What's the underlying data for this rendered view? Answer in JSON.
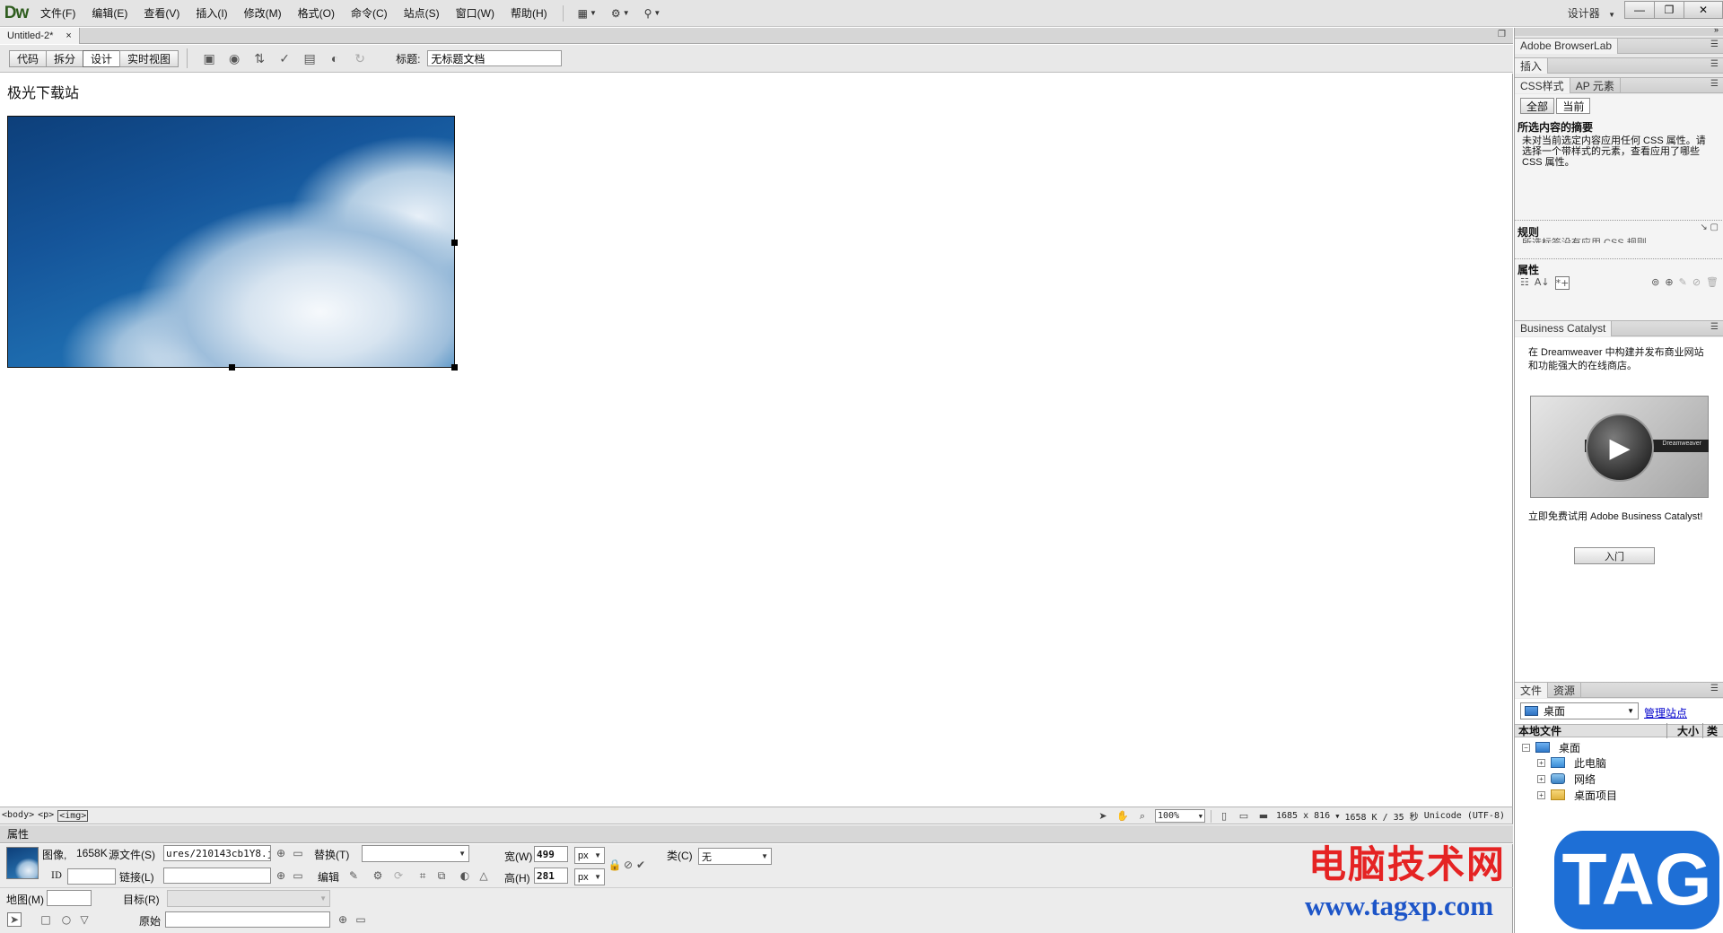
{
  "app": {
    "logo": "Dw",
    "menu": [
      "文件(F)",
      "编辑(E)",
      "查看(V)",
      "插入(I)",
      "修改(M)",
      "格式(O)",
      "命令(C)",
      "站点(S)",
      "窗口(W)",
      "帮助(H)"
    ],
    "workspace": "设计器",
    "window_controls": {
      "minimize": "—",
      "restore": "❐",
      "close": "✕"
    }
  },
  "document": {
    "tab_name": "Untitled-2*",
    "tab_close": "×",
    "view_buttons": [
      "代码",
      "拆分",
      "设计",
      "实时视图"
    ],
    "active_view": "设计",
    "title_label": "标题:",
    "title_value": "无标题文档",
    "body_text": "极光下载站"
  },
  "statusbar": {
    "tags": [
      "<body>",
      "<p>",
      "<img>"
    ],
    "zoom": "100%",
    "dimensions": "1685 x 816",
    "size_time": "1658 K / 35 秒",
    "encoding": "Unicode (UTF-8)"
  },
  "properties": {
    "header": "属性",
    "image_label": "图像,",
    "image_size": "1658K",
    "src_label": "源文件(S)",
    "src_value": "ures/210143cb1Y8.jpg",
    "link_label": "链接(L)",
    "link_value": "",
    "id_label": "ID",
    "id_value": "",
    "alt_label": "替换(T)",
    "alt_value": "",
    "edit_label": "编辑",
    "width_label": "宽(W)",
    "width_value": "499",
    "height_label": "高(H)",
    "height_value": "281",
    "unit": "px",
    "class_label": "类(C)",
    "class_value": "无",
    "map_label": "地图(M)",
    "map_value": "",
    "target_label": "目标(R)",
    "target_value": "",
    "original_label": "原始",
    "original_value": ""
  },
  "dock": {
    "browserlab": "Adobe BrowserLab",
    "insert": "插入",
    "css_tabs": [
      "CSS样式",
      "AP 元素"
    ],
    "css_mode_buttons": [
      "全部",
      "当前"
    ],
    "summary_heading": "所选内容的摘要",
    "summary_text": "未对当前选定内容应用任何 CSS 属性。请选择一个带样式的元素，查看应用了哪些 CSS 属性。",
    "rules_heading": "规则",
    "rules_text": "所选标签没有应用 CSS 规则。",
    "props_heading": "属性",
    "bc_title": "Business Catalyst",
    "bc_text": "在 Dreamweaver 中构建并发布商业网站和功能强大的在线商店。",
    "bc_video_caption": "Dreamweaver",
    "bc_cta": "立即免费试用 Adobe Business Catalyst!",
    "bc_enter": "入门",
    "files_tabs": [
      "文件",
      "资源"
    ],
    "site_select": "桌面",
    "manage_sites": "管理站点",
    "columns": {
      "local": "本地文件",
      "size": "大小",
      "type": "类"
    },
    "tree": [
      {
        "label": "桌面",
        "level": 0,
        "toggle": "−"
      },
      {
        "label": "此电脑",
        "level": 1,
        "toggle": "+"
      },
      {
        "label": "网络",
        "level": 1,
        "toggle": "+"
      },
      {
        "label": "桌面项目",
        "level": 1,
        "toggle": "+"
      }
    ]
  },
  "watermark": {
    "brand_cn": "电脑技术网",
    "url": "www.tagxp.com",
    "tag": "TAG"
  },
  "colors": {
    "link": "#0000cc",
    "watermark_red": "#e52323",
    "watermark_blue": "#1e6fd6"
  }
}
